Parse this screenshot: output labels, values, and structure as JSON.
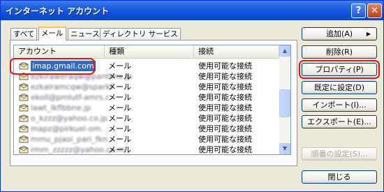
{
  "window": {
    "title": "インターネット アカウント",
    "help_glyph": "?",
    "close_glyph": "✕"
  },
  "tabs": [
    {
      "label": "すべて",
      "active": false
    },
    {
      "label": "メール",
      "active": true
    },
    {
      "label": "ニュース",
      "active": false
    },
    {
      "label": "ディレクトリ サービス",
      "active": false
    }
  ],
  "list": {
    "columns": [
      "アカウント",
      "種類",
      "接続"
    ],
    "rows": [
      {
        "account": "imap.gmail.com",
        "type": "メール",
        "connection": "使用可能な接続",
        "selected": true,
        "blurred": false
      },
      {
        "account": "ezkiraweraqw@pantlinx.jp",
        "type": "メール",
        "connection": "使用可能な接続",
        "selected": false,
        "blurred": true
      },
      {
        "account": "ezkalramcqw@sparkf",
        "type": "メール",
        "connection": "使用可能な接続",
        "selected": false,
        "blurred": true
      },
      {
        "account": "ekoll@pmlutf-amrs.c",
        "type": "メール",
        "connection": "使用可能な接続",
        "selected": false,
        "blurred": true
      },
      {
        "account": "lawt_lkflbbne.jp",
        "type": "メール",
        "connection": "使用可能な接続",
        "selected": false,
        "blurred": true
      },
      {
        "account": "o_kzzz@yahoo.co.jp",
        "type": "メール",
        "connection": "使用可能な接続",
        "selected": false,
        "blurred": true
      },
      {
        "account": "mapz@pirkuel-om.",
        "type": "メール",
        "connection": "使用可能な接続",
        "selected": false,
        "blurred": true
      },
      {
        "account": "mmu_pjaoi_pari_fkn..",
        "type": "メール",
        "connection": "使用可能な接続",
        "selected": false,
        "blurred": true
      },
      {
        "account": "rmm_zzzzz@yahoo.co.m",
        "type": "メール",
        "connection": "使用可能な接続",
        "selected": false,
        "blurred": true
      }
    ]
  },
  "buttons": {
    "add": "追加(A)",
    "add_arrow": "▶",
    "remove": "削除(R)",
    "properties": "プロパティ(P)",
    "set_default": "既定に設定(D)",
    "import": "インポート(I)...",
    "export": "エクスポート(E)...",
    "order": "順番の設定(S)...",
    "close": "閉じる"
  },
  "scrollbar": {
    "up_glyph": "▲",
    "down_glyph": "▼"
  },
  "colors": {
    "highlight": "#E8141C",
    "selection": "#316AC5",
    "titlebar": "#0A50D8"
  }
}
